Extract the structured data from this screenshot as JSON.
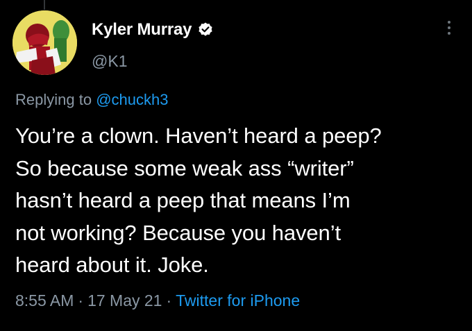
{
  "author": {
    "display_name": "Kyler Murray",
    "handle": "@K1",
    "verified": true,
    "avatar_icon": "profile-photo"
  },
  "reply": {
    "prefix": "Replying to",
    "mention": "@chuckh3"
  },
  "tweet": {
    "lines": [
      "You’re a clown. Haven’t heard a peep?",
      "So because some weak ass “writer”",
      "hasn’t heard a peep that means I’m",
      "not working? Because you haven’t",
      "heard about it. Joke."
    ]
  },
  "meta": {
    "time": "8:55 AM",
    "separator": "·",
    "date": "17 May 21",
    "source": "Twitter for iPhone"
  },
  "icons": {
    "more": "more-vertical-icon",
    "verified": "verified-badge-icon"
  },
  "colors": {
    "background": "#000000",
    "text": "#ffffff",
    "secondary": "#8b98a5",
    "accent": "#1d9bf0"
  }
}
